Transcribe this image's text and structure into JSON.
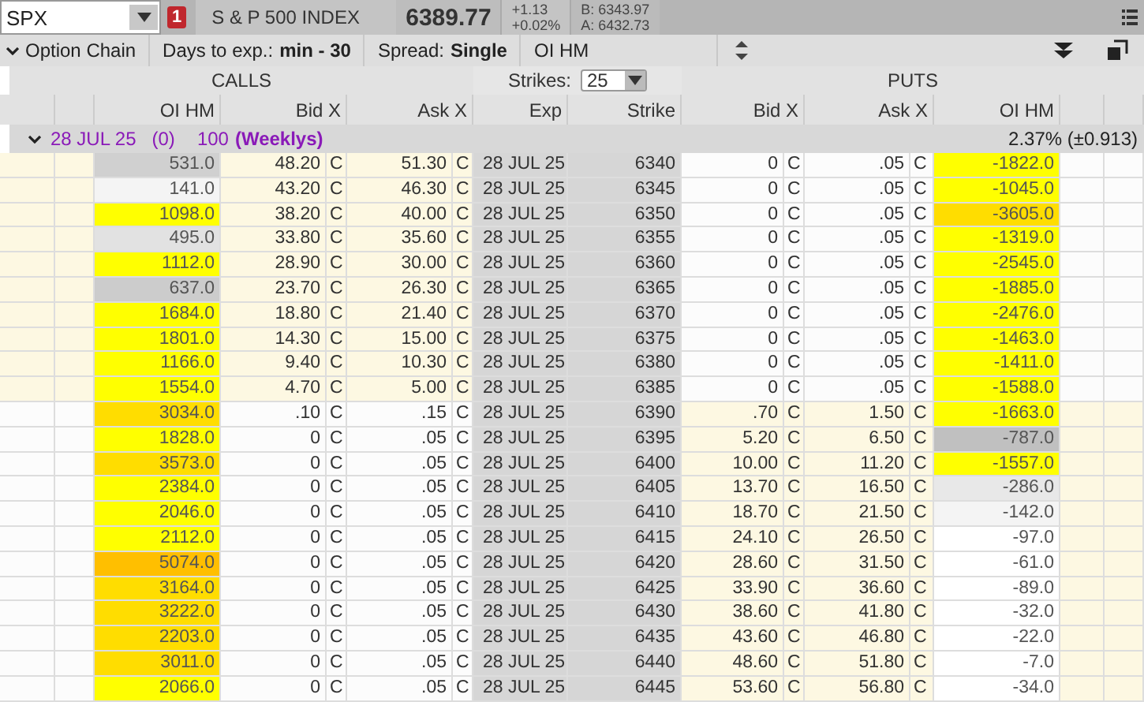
{
  "top_bar": {
    "symbol": "SPX",
    "alert_badge": "1",
    "description": "S & P 500 INDEX",
    "last": "6389.77",
    "change": "+1.13",
    "change_pct": "+0.02%",
    "bid": "B: 6343.97",
    "ask": "A: 6432.73"
  },
  "toolbar": {
    "section": "Option Chain",
    "days_label": "Days to exp.:",
    "days_value": "min - 30",
    "spread_label": "Spread:",
    "spread_value": "Single",
    "layout": "OI HM"
  },
  "section_header": {
    "calls": "CALLS",
    "strikes_label": "Strikes:",
    "strikes_value": "25",
    "puts": "PUTS"
  },
  "columns": [
    "OI HM",
    "Bid X",
    "Ask X",
    "Exp",
    "Strike",
    "Bid X",
    "Ask X",
    "OI HM"
  ],
  "expiration": {
    "expanded": true,
    "date": "28 JUL 25",
    "days": "(0)",
    "multiplier": "100",
    "type": "(Weeklys)",
    "implied_move": "2.37% (±0.913)"
  },
  "rows": [
    {
      "exp": "28 JUL 25",
      "strike": "6340",
      "call": {
        "itm": true,
        "oi": "531.0",
        "color": "#d0d0d0",
        "bid": "48.20",
        "bid_x": "C",
        "ask": "51.30",
        "ask_x": "C"
      },
      "put": {
        "itm": false,
        "bid": "0",
        "bid_x": "C",
        "ask": ".05",
        "ask_x": "C",
        "oi": "-1822.0",
        "color": "#ffff00"
      }
    },
    {
      "exp": "28 JUL 25",
      "strike": "6345",
      "call": {
        "itm": true,
        "oi": "141.0",
        "color": "#f4f4f4",
        "bid": "43.20",
        "bid_x": "C",
        "ask": "46.30",
        "ask_x": "C"
      },
      "put": {
        "itm": false,
        "bid": "0",
        "bid_x": "C",
        "ask": ".05",
        "ask_x": "C",
        "oi": "-1045.0",
        "color": "#ffff00"
      }
    },
    {
      "exp": "28 JUL 25",
      "strike": "6350",
      "call": {
        "itm": true,
        "oi": "1098.0",
        "color": "#ffff00",
        "bid": "38.20",
        "bid_x": "C",
        "ask": "40.00",
        "ask_x": "C"
      },
      "put": {
        "itm": false,
        "bid": "0",
        "bid_x": "C",
        "ask": ".05",
        "ask_x": "C",
        "oi": "-3605.0",
        "color": "#ffdd00"
      }
    },
    {
      "exp": "28 JUL 25",
      "strike": "6355",
      "call": {
        "itm": true,
        "oi": "495.0",
        "color": "#e2e2e2",
        "bid": "33.80",
        "bid_x": "C",
        "ask": "35.60",
        "ask_x": "C"
      },
      "put": {
        "itm": false,
        "bid": "0",
        "bid_x": "C",
        "ask": ".05",
        "ask_x": "C",
        "oi": "-1319.0",
        "color": "#ffff00"
      }
    },
    {
      "exp": "28 JUL 25",
      "strike": "6360",
      "call": {
        "itm": true,
        "oi": "1112.0",
        "color": "#ffff00",
        "bid": "28.90",
        "bid_x": "C",
        "ask": "30.00",
        "ask_x": "C"
      },
      "put": {
        "itm": false,
        "bid": "0",
        "bid_x": "C",
        "ask": ".05",
        "ask_x": "C",
        "oi": "-2545.0",
        "color": "#ffff00"
      }
    },
    {
      "exp": "28 JUL 25",
      "strike": "6365",
      "call": {
        "itm": true,
        "oi": "637.0",
        "color": "#cccccc",
        "bid": "23.70",
        "bid_x": "C",
        "ask": "26.30",
        "ask_x": "C"
      },
      "put": {
        "itm": false,
        "bid": "0",
        "bid_x": "C",
        "ask": ".05",
        "ask_x": "C",
        "oi": "-1885.0",
        "color": "#ffff00"
      }
    },
    {
      "exp": "28 JUL 25",
      "strike": "6370",
      "call": {
        "itm": true,
        "oi": "1684.0",
        "color": "#ffff00",
        "bid": "18.80",
        "bid_x": "C",
        "ask": "21.40",
        "ask_x": "C"
      },
      "put": {
        "itm": false,
        "bid": "0",
        "bid_x": "C",
        "ask": ".05",
        "ask_x": "C",
        "oi": "-2476.0",
        "color": "#ffff00"
      }
    },
    {
      "exp": "28 JUL 25",
      "strike": "6375",
      "call": {
        "itm": true,
        "oi": "1801.0",
        "color": "#ffff00",
        "bid": "14.30",
        "bid_x": "C",
        "ask": "15.00",
        "ask_x": "C"
      },
      "put": {
        "itm": false,
        "bid": "0",
        "bid_x": "C",
        "ask": ".05",
        "ask_x": "C",
        "oi": "-1463.0",
        "color": "#ffff00"
      }
    },
    {
      "exp": "28 JUL 25",
      "strike": "6380",
      "call": {
        "itm": true,
        "oi": "1166.0",
        "color": "#ffff00",
        "bid": "9.40",
        "bid_x": "C",
        "ask": "10.30",
        "ask_x": "C"
      },
      "put": {
        "itm": false,
        "bid": "0",
        "bid_x": "C",
        "ask": ".05",
        "ask_x": "C",
        "oi": "-1411.0",
        "color": "#ffff00"
      }
    },
    {
      "exp": "28 JUL 25",
      "strike": "6385",
      "call": {
        "itm": true,
        "oi": "1554.0",
        "color": "#ffff00",
        "bid": "4.70",
        "bid_x": "C",
        "ask": "5.00",
        "ask_x": "C"
      },
      "put": {
        "itm": false,
        "bid": "0",
        "bid_x": "C",
        "ask": ".05",
        "ask_x": "C",
        "oi": "-1588.0",
        "color": "#ffff00"
      }
    },
    {
      "exp": "28 JUL 25",
      "strike": "6390",
      "call": {
        "itm": false,
        "oi": "3034.0",
        "color": "#ffdd00",
        "bid": ".10",
        "bid_x": "C",
        "ask": ".15",
        "ask_x": "C"
      },
      "put": {
        "itm": true,
        "bid": ".70",
        "bid_x": "C",
        "ask": "1.50",
        "ask_x": "C",
        "oi": "-1663.0",
        "color": "#ffff00"
      }
    },
    {
      "exp": "28 JUL 25",
      "strike": "6395",
      "call": {
        "itm": false,
        "oi": "1828.0",
        "color": "#ffff00",
        "bid": "0",
        "bid_x": "C",
        "ask": ".05",
        "ask_x": "C"
      },
      "put": {
        "itm": true,
        "bid": "5.20",
        "bid_x": "C",
        "ask": "6.50",
        "ask_x": "C",
        "oi": "-787.0",
        "color": "#c0c0c0"
      }
    },
    {
      "exp": "28 JUL 25",
      "strike": "6400",
      "call": {
        "itm": false,
        "oi": "3573.0",
        "color": "#ffdd00",
        "bid": "0",
        "bid_x": "C",
        "ask": ".05",
        "ask_x": "C"
      },
      "put": {
        "itm": true,
        "bid": "10.00",
        "bid_x": "C",
        "ask": "11.20",
        "ask_x": "C",
        "oi": "-1557.0",
        "color": "#ffff00"
      }
    },
    {
      "exp": "28 JUL 25",
      "strike": "6405",
      "call": {
        "itm": false,
        "oi": "2384.0",
        "color": "#ffff00",
        "bid": "0",
        "bid_x": "C",
        "ask": ".05",
        "ask_x": "C"
      },
      "put": {
        "itm": true,
        "bid": "13.70",
        "bid_x": "C",
        "ask": "16.50",
        "ask_x": "C",
        "oi": "-286.0",
        "color": "#e8e8e8"
      }
    },
    {
      "exp": "28 JUL 25",
      "strike": "6410",
      "call": {
        "itm": false,
        "oi": "2046.0",
        "color": "#ffff00",
        "bid": "0",
        "bid_x": "C",
        "ask": ".05",
        "ask_x": "C"
      },
      "put": {
        "itm": true,
        "bid": "18.70",
        "bid_x": "C",
        "ask": "21.50",
        "ask_x": "C",
        "oi": "-142.0",
        "color": "#f4f4f4"
      }
    },
    {
      "exp": "28 JUL 25",
      "strike": "6415",
      "call": {
        "itm": false,
        "oi": "2112.0",
        "color": "#ffff00",
        "bid": "0",
        "bid_x": "C",
        "ask": ".05",
        "ask_x": "C"
      },
      "put": {
        "itm": true,
        "bid": "24.10",
        "bid_x": "C",
        "ask": "26.50",
        "ask_x": "C",
        "oi": "-97.0",
        "color": "#ffffff"
      }
    },
    {
      "exp": "28 JUL 25",
      "strike": "6420",
      "call": {
        "itm": false,
        "oi": "5074.0",
        "color": "#ffbf00",
        "bid": "0",
        "bid_x": "C",
        "ask": ".05",
        "ask_x": "C"
      },
      "put": {
        "itm": true,
        "bid": "28.60",
        "bid_x": "C",
        "ask": "31.50",
        "ask_x": "C",
        "oi": "-61.0",
        "color": "#ffffff"
      }
    },
    {
      "exp": "28 JUL 25",
      "strike": "6425",
      "call": {
        "itm": false,
        "oi": "3164.0",
        "color": "#ffdd00",
        "bid": "0",
        "bid_x": "C",
        "ask": ".05",
        "ask_x": "C"
      },
      "put": {
        "itm": true,
        "bid": "33.90",
        "bid_x": "C",
        "ask": "36.60",
        "ask_x": "C",
        "oi": "-89.0",
        "color": "#ffffff"
      }
    },
    {
      "exp": "28 JUL 25",
      "strike": "6430",
      "call": {
        "itm": false,
        "oi": "3222.0",
        "color": "#ffdd00",
        "bid": "0",
        "bid_x": "C",
        "ask": ".05",
        "ask_x": "C"
      },
      "put": {
        "itm": true,
        "bid": "38.60",
        "bid_x": "C",
        "ask": "41.80",
        "ask_x": "C",
        "oi": "-32.0",
        "color": "#ffffff"
      }
    },
    {
      "exp": "28 JUL 25",
      "strike": "6435",
      "call": {
        "itm": false,
        "oi": "2203.0",
        "color": "#ffdd00",
        "bid": "0",
        "bid_x": "C",
        "ask": ".05",
        "ask_x": "C"
      },
      "put": {
        "itm": true,
        "bid": "43.60",
        "bid_x": "C",
        "ask": "46.80",
        "ask_x": "C",
        "oi": "-22.0",
        "color": "#ffffff"
      }
    },
    {
      "exp": "28 JUL 25",
      "strike": "6440",
      "call": {
        "itm": false,
        "oi": "3011.0",
        "color": "#ffdd00",
        "bid": "0",
        "bid_x": "C",
        "ask": ".05",
        "ask_x": "C"
      },
      "put": {
        "itm": true,
        "bid": "48.60",
        "bid_x": "C",
        "ask": "51.80",
        "ask_x": "C",
        "oi": "-7.0",
        "color": "#ffffff"
      }
    },
    {
      "exp": "28 JUL 25",
      "strike": "6445",
      "call": {
        "itm": false,
        "oi": "2066.0",
        "color": "#ffff00",
        "bid": "0",
        "bid_x": "C",
        "ask": ".05",
        "ask_x": "C"
      },
      "put": {
        "itm": true,
        "bid": "53.60",
        "bid_x": "C",
        "ask": "56.80",
        "ask_x": "C",
        "oi": "-34.0",
        "color": "#ffffff"
      }
    }
  ]
}
